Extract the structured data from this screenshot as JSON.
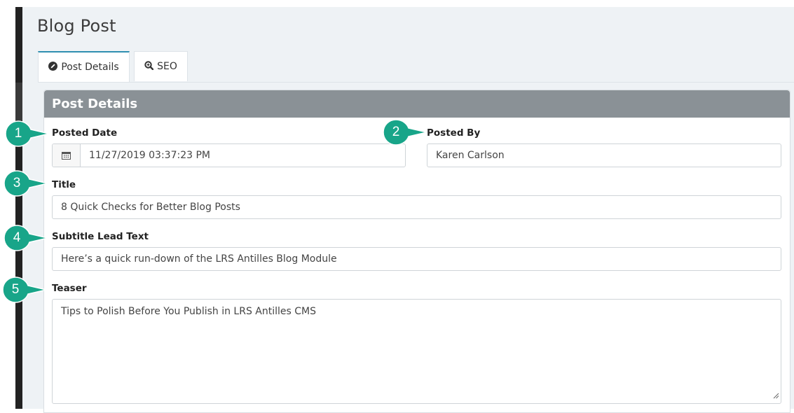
{
  "page": {
    "title": "Blog Post"
  },
  "tabs": [
    {
      "label": "Post Details",
      "icon": "pencil-icon",
      "active": true
    },
    {
      "label": "SEO",
      "icon": "search-plus-icon",
      "active": false
    }
  ],
  "panel": {
    "title": "Post Details"
  },
  "fields": {
    "posted_date": {
      "label": "Posted Date",
      "value": "11/27/2019 03:37:23 PM",
      "icon": "calendar-icon"
    },
    "posted_by": {
      "label": "Posted By",
      "value": "Karen Carlson"
    },
    "title": {
      "label": "Title",
      "value": "8 Quick Checks for Better Blog Posts"
    },
    "subtitle": {
      "label": "Subtitle Lead Text",
      "value": "Here’s a quick run-down of the LRS Antilles Blog Module"
    },
    "teaser": {
      "label": "Teaser",
      "value": "Tips to Polish Before You Publish in LRS Antilles CMS"
    }
  },
  "callouts": [
    "1",
    "2",
    "3",
    "4",
    "5"
  ],
  "colors": {
    "callout": "#18a589",
    "panel_header": "#8a9196",
    "tab_accent": "#2f8fb0",
    "background": "#eef2f5"
  }
}
